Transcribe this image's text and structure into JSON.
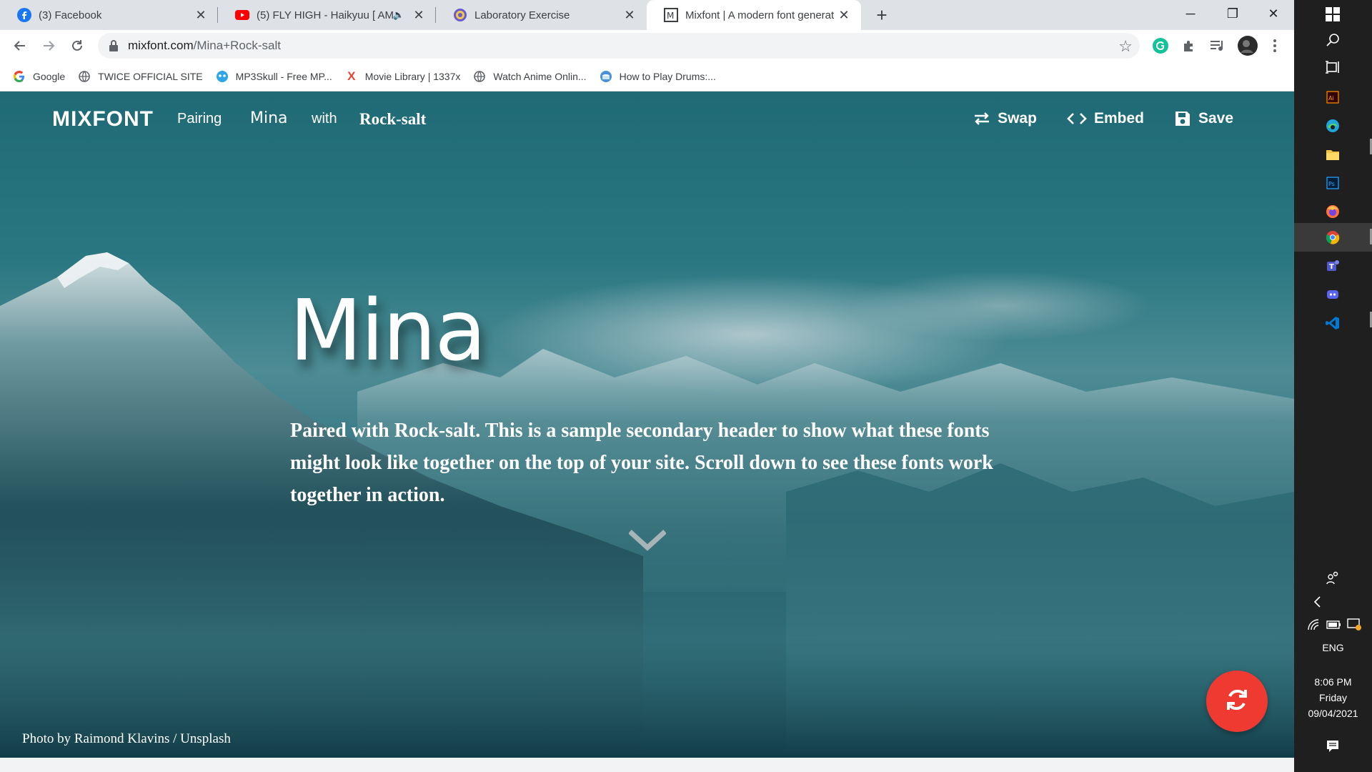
{
  "browser": {
    "tabs": [
      {
        "title": "(3) Facebook",
        "icon": "facebook-icon"
      },
      {
        "title": "(5) FLY HIGH - Haikyuu [ AM",
        "icon": "youtube-icon",
        "audio": true
      },
      {
        "title": "Laboratory Exercise",
        "icon": "globe-icon"
      },
      {
        "title": "Mixfont | A modern font generat",
        "icon": "mixfont-icon",
        "active": true
      }
    ],
    "url_host": "mixfont.com",
    "url_path": "/Mina+Rock-salt",
    "bookmarks": [
      {
        "label": "Google",
        "icon": "google-icon"
      },
      {
        "label": "TWICE OFFICIAL SITE",
        "icon": "globe-icon"
      },
      {
        "label": "MP3Skull - Free MP...",
        "icon": "mp3skull-icon"
      },
      {
        "label": "Movie Library | 1337x",
        "icon": "x-icon"
      },
      {
        "label": "Watch Anime Onlin...",
        "icon": "globe-icon"
      },
      {
        "label": "How to Play Drums:...",
        "icon": "drum-icon"
      }
    ]
  },
  "site": {
    "logo": "MIXFONT",
    "nav_pairing": "Pairing",
    "font_primary": "Mina",
    "nav_with": "with",
    "font_secondary": "Rock-salt",
    "actions": {
      "swap": "Swap",
      "embed": "Embed",
      "save": "Save"
    },
    "hero_title": "Mina",
    "hero_desc": "Paired with Rock-salt. This is a sample secondary header to show what these fonts might look like together on the top of your site. Scroll down to see these fonts work together in action.",
    "photo_credit": "Photo by Raimond Klavins / Unsplash"
  },
  "taskbar": {
    "language": "ENG",
    "time": "8:06 PM",
    "day": "Friday",
    "date": "09/04/2021"
  },
  "colors": {
    "fab": "#ef3a31",
    "teal": "#1f6a75"
  }
}
